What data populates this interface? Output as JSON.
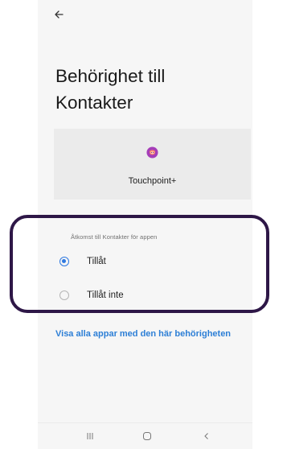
{
  "page": {
    "title": "Behörighet till\nKontakter"
  },
  "app": {
    "name": "Touchpoint+",
    "icon": "touchpoint-app-icon"
  },
  "permission": {
    "section_label": "Åtkomst till Kontakter för appen",
    "options": [
      {
        "label": "Tillåt",
        "selected": true
      },
      {
        "label": "Tillåt inte",
        "selected": false
      }
    ]
  },
  "link": {
    "label": "Visa alla appar med den här behörigheten"
  },
  "navbar": {
    "buttons": [
      "recents-icon",
      "home-icon",
      "back-icon"
    ]
  },
  "colors": {
    "accent": "#2f79e0",
    "link": "#2d7fd6",
    "highlight_border": "#2e1747",
    "app_icon": "#a53db8"
  }
}
